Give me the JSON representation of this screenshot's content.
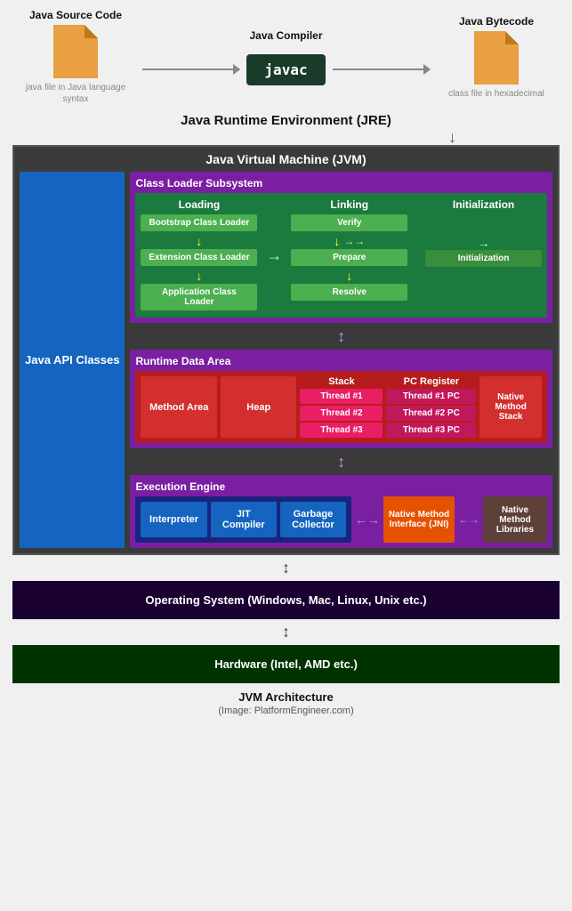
{
  "top": {
    "source_title": "Java Source Code",
    "source_caption": "java file in Java language syntax",
    "compiler_title": "Java Compiler",
    "compiler_label": "javac",
    "bytecode_title": "Java Bytecode",
    "bytecode_caption": "class file in hexadecimal"
  },
  "jre": {
    "label": "Java Runtime Environment (JRE)"
  },
  "jvm": {
    "title": "Java Virtual Machine (JVM)",
    "api_label": "Java API Classes",
    "cls": {
      "title": "Class Loader Subsystem",
      "loading_title": "Loading",
      "bootstrap": "Bootstrap Class Loader",
      "extension": "Extension Class Loader",
      "application": "Application Class Loader",
      "linking_title": "Linking",
      "verify": "Verify",
      "prepare": "Prepare",
      "resolve": "Resolve",
      "init_title": "Initialization",
      "initialization": "Initialization"
    },
    "rda": {
      "title": "Runtime Data Area",
      "method_area": "Method Area",
      "heap": "Heap",
      "stack_title": "Stack",
      "thread1": "Thread #1",
      "thread2": "Thread #2",
      "thread3": "Thread #3",
      "pc_title": "PC Register",
      "pc1": "Thread #1 PC",
      "pc2": "Thread #2 PC",
      "pc3": "Thread #3 PC",
      "native_method_stack": "Native Method Stack"
    },
    "exec": {
      "title": "Execution Engine",
      "interpreter": "Interpreter",
      "jit": "JIT Compiler",
      "gc": "Garbage Collector",
      "nmi": "Native Method Interface (JNI)",
      "nml": "Native Method Libraries"
    }
  },
  "os": {
    "label": "Operating System (Windows, Mac, Linux, Unix etc.)"
  },
  "hw": {
    "label": "Hardware (Intel, AMD etc.)"
  },
  "footer": {
    "title": "JVM Architecture",
    "subtitle": "(Image: PlatformEngineer.com)"
  }
}
